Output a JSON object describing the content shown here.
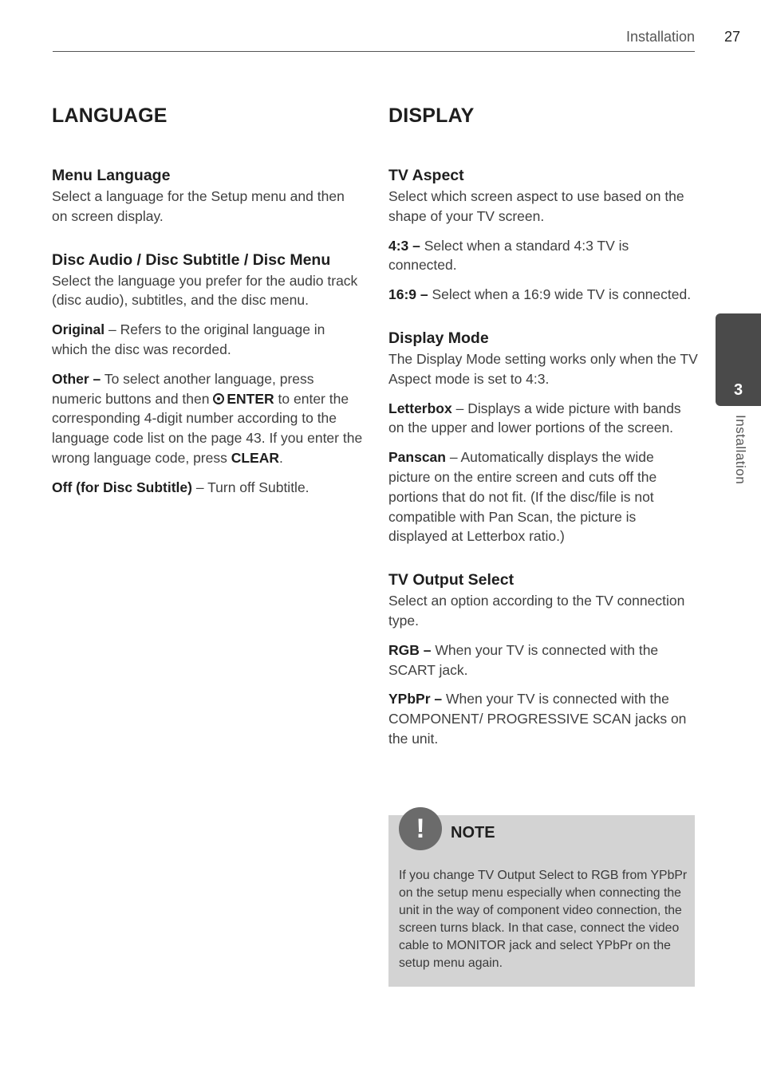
{
  "header": {
    "section": "Installation",
    "page_number": "27"
  },
  "side_tab": {
    "chapter_number": "3",
    "chapter_label": "Installation"
  },
  "language": {
    "title": "LANGUAGE",
    "menu_language": {
      "heading": "Menu Language",
      "body": "Select a language for the Setup menu and then on screen display."
    },
    "disc_audio": {
      "heading": "Disc Audio / Disc Subtitle / Disc Menu",
      "body": "Select the language you prefer for the audio track (disc audio), subtitles, and the disc menu.",
      "original_term": "Original",
      "original_text": " – Refers to the original language in which the disc was recorded.",
      "other_term": "Other –",
      "other_text_1": " To select another language, press numeric buttons and then ",
      "enter_label": "ENTER",
      "other_text_2": " to enter the corresponding 4-digit number according to the language code list on the page 43. If you enter the wrong language code, press ",
      "clear_label": "CLEAR",
      "other_text_3": ".",
      "off_term": "Off (for Disc Subtitle)",
      "off_text": " – Turn off Subtitle."
    }
  },
  "display": {
    "title": "DISPLAY",
    "tv_aspect": {
      "heading": "TV Aspect",
      "body": "Select which screen aspect to use based on the shape of your TV screen.",
      "opt1_term": "4:3 –",
      "opt1_text": " Select when a standard 4:3 TV is connected.",
      "opt2_term": "16:9 –",
      "opt2_text": " Select when a 16:9 wide TV is connected."
    },
    "display_mode": {
      "heading": "Display Mode",
      "body": "The Display Mode setting works only when the TV Aspect mode is set to 4:3.",
      "letterbox_term": "Letterbox",
      "letterbox_text": " – Displays a wide picture with bands on the upper and lower portions of the screen.",
      "panscan_term": "Panscan",
      "panscan_text": " – Automatically displays the wide picture on the entire screen and cuts off the portions that do not fit. (If the disc/file is not compatible with Pan Scan, the picture is displayed at Letterbox ratio.)"
    },
    "tv_output": {
      "heading": "TV Output Select",
      "body": "Select an option according to the TV connection type.",
      "rgb_term": "RGB –",
      "rgb_text": " When your TV is connected with the SCART jack.",
      "ypbpr_term": "YPbPr –",
      "ypbpr_text": " When your TV is connected with the COMPONENT/ PROGRESSIVE SCAN jacks on the unit."
    }
  },
  "note": {
    "icon_glyph": "!",
    "title": "NOTE",
    "text": "If you change TV Output Select to RGB from YPbPr on the setup menu especially when connecting the unit in the way of component video connection, the screen turns black. In that case, connect the video cable to MONITOR jack and select YPbPr on the setup menu again."
  }
}
